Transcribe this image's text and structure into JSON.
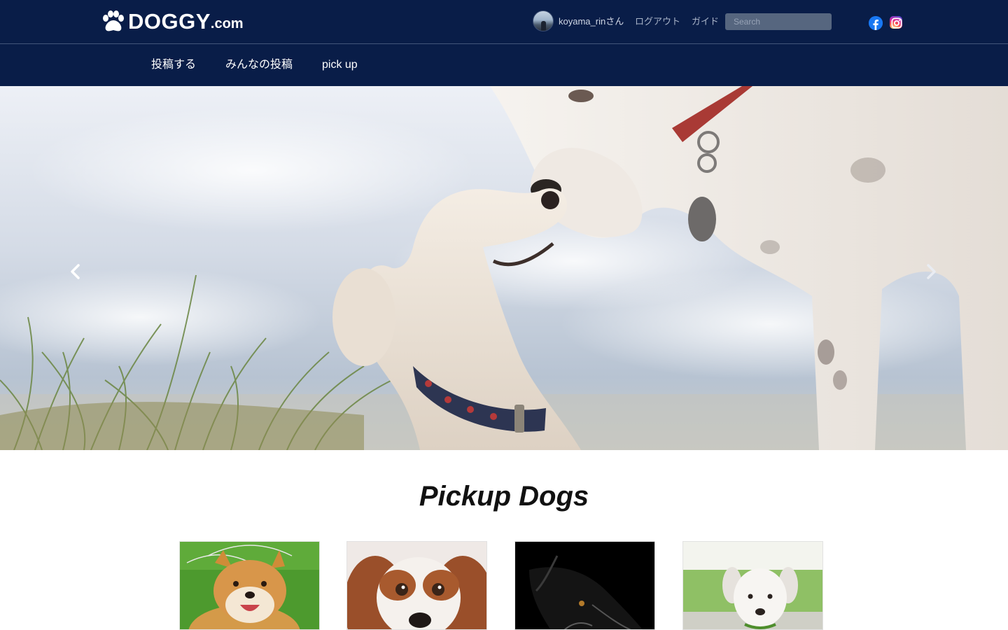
{
  "header": {
    "logo": {
      "brand": "DOGGY",
      "suffix": ".com",
      "icon": "paw-icon"
    },
    "user": {
      "name": "koyama_rinさん",
      "avatar": "avatar"
    },
    "logout_label": "ログアウト",
    "guide_label": "ガイド",
    "search": {
      "placeholder": "Search",
      "value": ""
    },
    "social": [
      {
        "icon": "facebook-icon",
        "color": "#1877f2"
      },
      {
        "icon": "instagram-icon",
        "color": "#d6249f"
      }
    ]
  },
  "nav": {
    "items": [
      {
        "label": "投稿する"
      },
      {
        "label": "みんなの投稿"
      },
      {
        "label": "pick up"
      }
    ]
  },
  "carousel": {
    "prev_icon": "chevron-left-icon",
    "next_icon": "chevron-right-icon"
  },
  "pickup": {
    "title": "Pickup Dogs",
    "cards": [
      {
        "image": "shiba-inu-photo"
      },
      {
        "image": "cavalier-spaniel-photo"
      },
      {
        "image": "black-dog-photo"
      },
      {
        "image": "white-puppy-photo"
      }
    ]
  },
  "colors": {
    "header_bg": "#091d48",
    "nav_text": "#ffffff",
    "muted_link": "#a9b4c8",
    "search_bg": "#56667f"
  }
}
